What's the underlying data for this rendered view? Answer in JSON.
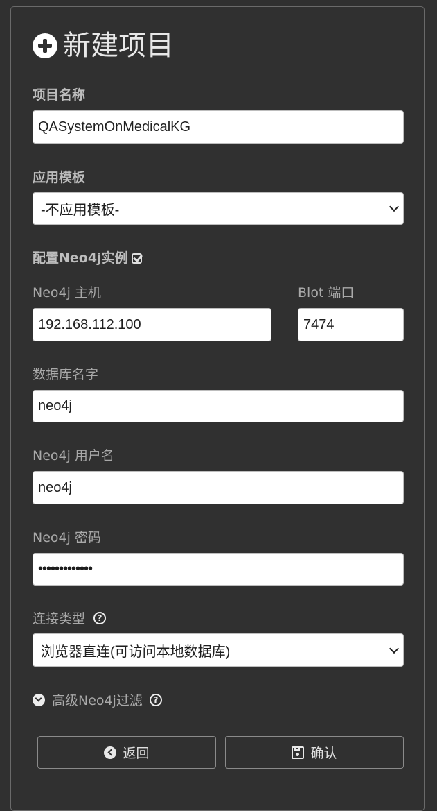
{
  "header": {
    "title": "新建项目",
    "icon": "plus-circle-icon"
  },
  "form": {
    "project_name": {
      "label": "项目名称",
      "value": "QASystemOnMedicalKG"
    },
    "template": {
      "label": "应用模板",
      "selected": "-不应用模板-"
    },
    "neo4j_config": {
      "label": "配置Neo4j实例",
      "checked": true
    },
    "host": {
      "label": "Neo4j 主机",
      "value": "192.168.112.100"
    },
    "port": {
      "label": "Blot 端口",
      "value": "7474"
    },
    "database": {
      "label": "数据库名字",
      "value": "neo4j"
    },
    "username": {
      "label": "Neo4j 用户名",
      "value": "neo4j"
    },
    "password": {
      "label": "Neo4j 密码",
      "value": "•••••••••••••"
    },
    "connection_type": {
      "label": "连接类型",
      "selected": "浏览器直连(可访问本地数据库)"
    },
    "advanced": {
      "label": "高级Neo4j过滤"
    }
  },
  "buttons": {
    "back": "返回",
    "confirm": "确认"
  }
}
